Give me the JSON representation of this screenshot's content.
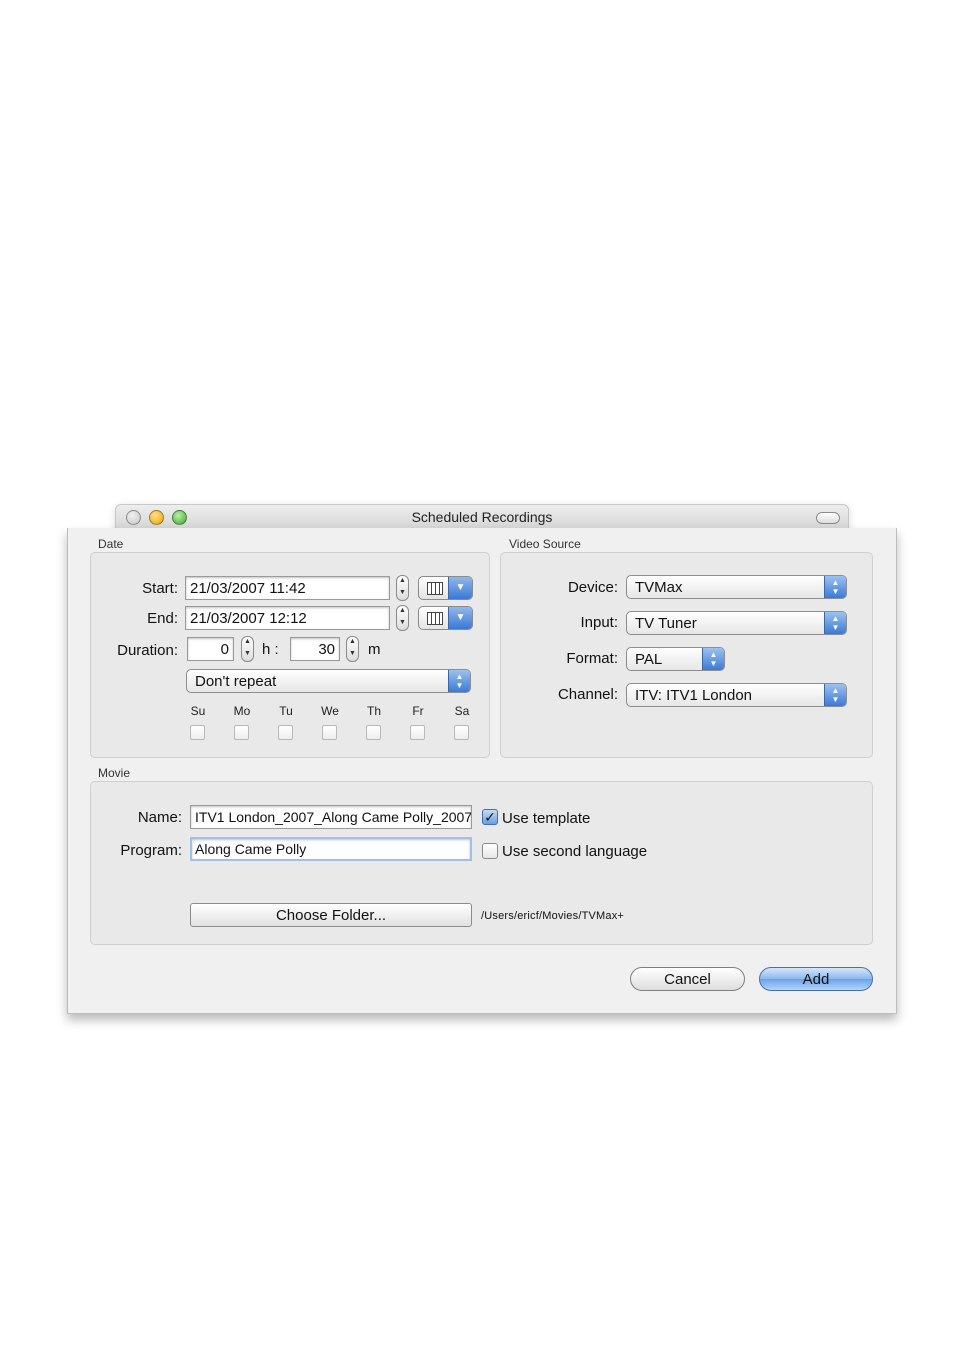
{
  "window": {
    "title": "Scheduled Recordings"
  },
  "date": {
    "legend": "Date",
    "start_label": "Start:",
    "start_value": "21/03/2007 11:42",
    "end_label": "End:",
    "end_value": "21/03/2007 12:12",
    "duration_label": "Duration:",
    "duration_hours": "0",
    "hours_unit": "h :",
    "duration_minutes": "30",
    "minutes_unit": "m",
    "repeat_selected": "Don't repeat",
    "days": [
      "Su",
      "Mo",
      "Tu",
      "We",
      "Th",
      "Fr",
      "Sa"
    ]
  },
  "video_source": {
    "legend": "Video Source",
    "device_label": "Device:",
    "device_value": "TVMax",
    "input_label": "Input:",
    "input_value": "TV Tuner",
    "format_label": "Format:",
    "format_value": "PAL",
    "channel_label": "Channel:",
    "channel_value": "ITV: ITV1 London"
  },
  "movie": {
    "legend": "Movie",
    "name_label": "Name:",
    "name_value": "ITV1 London_2007_Along Came Polly_2007",
    "use_template_label": "Use template",
    "use_template_checked": true,
    "program_label": "Program:",
    "program_value": "Along Came Polly",
    "second_language_label": "Use second language",
    "second_language_checked": false,
    "choose_folder_label": "Choose Folder...",
    "folder_path": "/Users/ericf/Movies/TVMax+"
  },
  "actions": {
    "cancel_label": "Cancel",
    "add_label": "Add"
  },
  "icons": {
    "calendar": "calendar-icon",
    "stepper": "stepper-arrows-icon",
    "popup": "popup-arrows-icon",
    "check": "checkmark-icon"
  }
}
